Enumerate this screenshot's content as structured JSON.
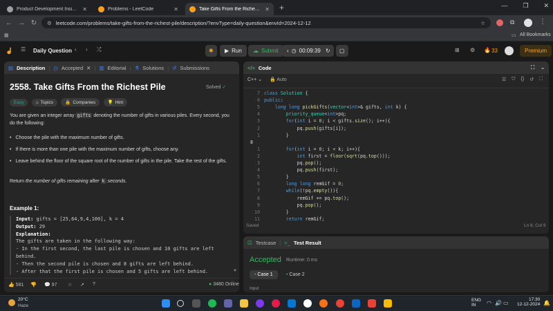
{
  "browser": {
    "tabs": [
      {
        "title": "Product Development Insights",
        "color": "#9aa0a6"
      },
      {
        "title": "Problems - LeetCode",
        "color": "#ffa116"
      },
      {
        "title": "Take Gifts From the Richest Pile",
        "color": "#ffa116"
      }
    ],
    "url": "leetcode.com/problems/take-gifts-from-the-richest-pile/description/?envType=daily-question&envId=2024-12-12",
    "all_bookmarks": "All Bookmarks"
  },
  "header": {
    "daily": "Daily Question",
    "run": "Run",
    "submit": "Submit",
    "timer": "00:09:39",
    "streak": "33",
    "premium": "Premium"
  },
  "desc_tabs": [
    "Description",
    "Accepted",
    "Editorial",
    "Solutions",
    "Submissions"
  ],
  "problem": {
    "title": "2558. Take Gifts From the Richest Pile",
    "status": "Solved",
    "difficulty": "Easy",
    "chips": [
      "Topics",
      "Companies",
      "Hint"
    ],
    "intro_a": "You are given an integer array ",
    "intro_code": "gifts",
    "intro_b": " denoting the number of gifts in various piles. Every second, you do the following:",
    "bullets": [
      "Choose the pile with the maximum number of gifts.",
      "If there is more than one pile with the maximum number of gifts, choose any.",
      "Leave behind the floor of the square root of the number of gifts in the pile. Take the rest of the gifts."
    ],
    "ret_a": "Return ",
    "ret_b": "the number of gifts remaining after ",
    "ret_code": "k",
    "ret_c": " seconds.",
    "example_title": "Example 1:",
    "ex_lines": [
      {
        "k": "Input: ",
        "v": "gifts = [25,64,9,4,100], k = 4"
      },
      {
        "k": "Output: ",
        "v": "29"
      },
      {
        "k": "Explanation:",
        "v": ""
      },
      {
        "k": "",
        "v": "The gifts are taken in the following way:"
      },
      {
        "k": "",
        "v": "- In the first second, the last pile is chosen and 10 gifts are left"
      },
      {
        "k": "",
        "v": "behind."
      },
      {
        "k": "",
        "v": "- Then the second pile is chosen and 8 gifts are left behind."
      },
      {
        "k": "",
        "v": "- After that the first pile is chosen and 5 gifts are left behind."
      }
    ]
  },
  "footer": {
    "likes": "581",
    "comments": "97",
    "online": "3480 Online"
  },
  "editor": {
    "title": "Code",
    "lang": "C++",
    "auto": "Auto",
    "saved": "Saved",
    "pos": "Ln 8, Col 9",
    "lines": [
      {
        "n": "7",
        "t": "class Solution {"
      },
      {
        "n": "6",
        "t": "public:"
      },
      {
        "n": "5",
        "t": "    long long pickGifts(vector<int>& gifts, int k) {"
      },
      {
        "n": "4",
        "t": "        priority_queue<int>pq;"
      },
      {
        "n": "3",
        "t": "        for(int i = 0; i < gifts.size(); i++){"
      },
      {
        "n": "2",
        "t": "            pq.push(gifts[i]);"
      },
      {
        "n": "1",
        "t": "        }"
      },
      {
        "n": "8",
        "t": ""
      },
      {
        "n": "1",
        "t": "        for(int i = 0; i < k; i++){"
      },
      {
        "n": "2",
        "t": "            int first = floor(sqrt(pq.top()));"
      },
      {
        "n": "3",
        "t": "            pq.pop();"
      },
      {
        "n": "4",
        "t": "            pq.push(first);"
      },
      {
        "n": "5",
        "t": "        }"
      },
      {
        "n": "6",
        "t": "        long long remGif = 0;"
      },
      {
        "n": "7",
        "t": "        while(!pq.empty()){"
      },
      {
        "n": "8",
        "t": "            remGif += pq.top();"
      },
      {
        "n": "9",
        "t": "            pq.pop();"
      },
      {
        "n": "10",
        "t": "        }"
      },
      {
        "n": "11",
        "t": "        return remGif;"
      }
    ]
  },
  "results": {
    "tab1": "Testcase",
    "tab2": "Test Result",
    "accepted": "Accepted",
    "runtime": "Runtime: 0 ms",
    "case1": "Case 1",
    "case2": "Case 2",
    "input": "Input"
  },
  "taskbar": {
    "temp": "20°C",
    "weather": "Haze",
    "lang1": "ENG",
    "lang2": "IN",
    "time": "17:30",
    "date": "12-12-2024"
  }
}
